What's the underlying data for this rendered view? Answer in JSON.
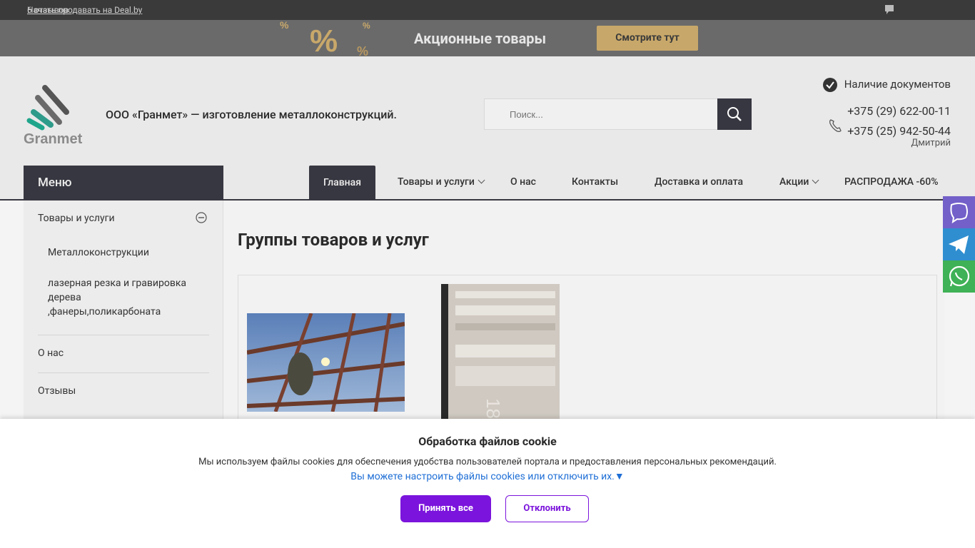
{
  "topbar": {
    "sell_link": "Начать продавать на Deal.by",
    "reviews_link": "6 отзывов"
  },
  "promo": {
    "title": "Акционные товары",
    "button": "Смотрите тут",
    "accent": "#c8a86a"
  },
  "header": {
    "company": "ООО «Гранмет» — изготовление металлоконструкций.",
    "logo_text": "Granmet",
    "search_placeholder": "Поиск...",
    "docs": "Наличие документов",
    "phone1": "+375 (29) 622-00-11",
    "phone2": "+375 (25) 942-50-44",
    "contact_person": "Дмитрий"
  },
  "nav": {
    "menu": "Меню",
    "items": [
      "Главная",
      "Товары и услуги",
      "О нас",
      "Контакты",
      "Доставка и оплата",
      "Акции",
      "РАСПРОДАЖА -60%"
    ]
  },
  "sidebar": {
    "section": "Товары и услуги",
    "sub1": "Металлоконструкции",
    "sub2_l1": "лазерная резка и гравировка",
    "sub2_l2": "дерева",
    "sub2_l3": ",фанеры,поликарбоната",
    "about": "О нас",
    "reviews": "Отзывы"
  },
  "main": {
    "title": "Группы товаров и услуг"
  },
  "cookie": {
    "title": "Обработка файлов cookie",
    "desc": "Мы используем файлы cookies для обеспечения удобства пользователей портала и предоставления персональных рекомендаций.",
    "link": "Вы можете настроить файлы cookies или отключить их.▼",
    "accept": "Принять все",
    "decline": "Отклонить",
    "accent": "#7b14dc"
  },
  "social": {
    "viber": "viber-icon",
    "telegram": "telegram-icon",
    "whatsapp": "whatsapp-icon"
  }
}
